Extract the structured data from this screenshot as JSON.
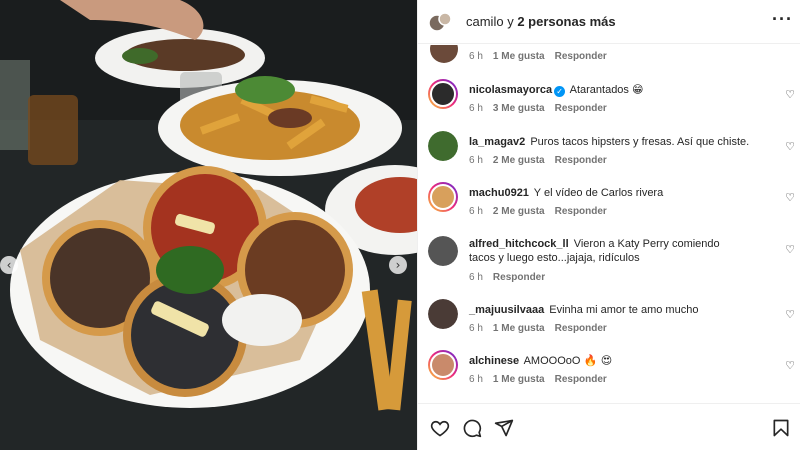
{
  "header": {
    "username": "camilo",
    "suffix": " y ",
    "others": "2 personas más",
    "more_icon": "more-horizontal-icon"
  },
  "previous_comment": {
    "time": "6 h",
    "likes": "1 Me gusta",
    "reply": "Responder"
  },
  "comments": [
    {
      "username": "nicolasmayorca",
      "verified": true,
      "text": "Atarantados",
      "emoji": "😁",
      "time": "6 h",
      "likes": "3 Me gusta",
      "reply": "Responder",
      "avatar_color": "#2b2b2b",
      "ring": true
    },
    {
      "username": "la_magav2",
      "verified": false,
      "text": "Puros tacos hipsters y fresas. Así que chiste.",
      "emoji": "",
      "time": "6 h",
      "likes": "2 Me gusta",
      "reply": "Responder",
      "avatar_color": "#3f6b2e",
      "ring": false
    },
    {
      "username": "machu0921",
      "verified": false,
      "text": "Y el vídeo de Carlos rivera",
      "emoji": "",
      "time": "6 h",
      "likes": "2 Me gusta",
      "reply": "Responder",
      "avatar_color": "#d8a05c",
      "ring": true
    },
    {
      "username": "alfred_hitchcock_ll",
      "verified": false,
      "text": "Vieron a Katy Perry comiendo tacos y luego esto...jajaja, ridículos",
      "emoji": "",
      "time": "6 h",
      "likes": "",
      "reply": "Responder",
      "avatar_color": "#555555",
      "ring": false
    },
    {
      "username": "_majuusilvaaa",
      "verified": false,
      "text": "Evinha mi amor te amo mucho",
      "emoji": "",
      "time": "6 h",
      "likes": "1 Me gusta",
      "reply": "Responder",
      "avatar_color": "#4a3b36",
      "ring": false
    },
    {
      "username": "alchinese",
      "verified": false,
      "text": "AMOOOoO",
      "emoji": "🔥 😍",
      "time": "6 h",
      "likes": "1 Me gusta",
      "reply": "Responder",
      "avatar_color": "#c98a6b",
      "ring": true
    }
  ],
  "actions": {
    "like_icon": "heart-icon",
    "comment_icon": "comment-icon",
    "share_icon": "send-icon",
    "save_icon": "bookmark-icon"
  },
  "photo": {
    "prev_arrow": "‹",
    "next_arrow": "›"
  },
  "colors": {
    "link_blue": "#0095f6",
    "meta_grey": "#737373",
    "text": "#262626"
  }
}
